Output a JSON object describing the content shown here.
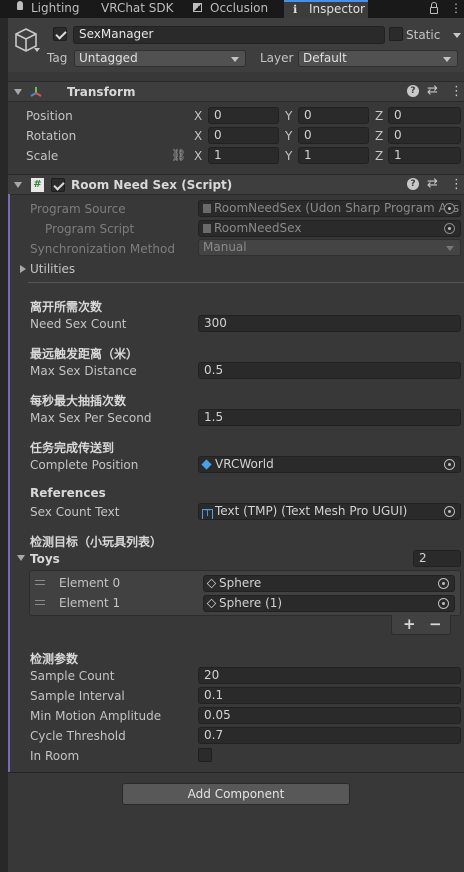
{
  "tabs": [
    {
      "label": "Lighting",
      "icon": "lightbulb-icon"
    },
    {
      "label": "VRChat SDK"
    },
    {
      "label": "Occlusion",
      "icon": "occlusion-icon"
    },
    {
      "label": "Inspector",
      "icon": "info-icon"
    }
  ],
  "gameobject": {
    "name": "SexManager",
    "static_label": "Static",
    "tag_label": "Tag",
    "tag_value": "Untagged",
    "layer_label": "Layer",
    "layer_value": "Default"
  },
  "transform": {
    "title": "Transform",
    "rows": [
      {
        "label": "Position",
        "x": "0",
        "y": "0",
        "z": "0"
      },
      {
        "label": "Rotation",
        "x": "0",
        "y": "0",
        "z": "0"
      },
      {
        "label": "Scale",
        "x": "1",
        "y": "1",
        "z": "1"
      }
    ],
    "axis": {
      "x": "X",
      "y": "Y",
      "z": "Z"
    }
  },
  "script": {
    "title": "Room Need Sex (Script)",
    "program_source_label": "Program Source",
    "program_source_value": "RoomNeedSex (Udon Sharp Program Ass",
    "program_script_label": "Program Script",
    "program_script_value": "RoomNeedSex",
    "sync_label": "Synchronization Method",
    "sync_value": "Manual",
    "utilities_label": "Utilities"
  },
  "sections": {
    "need_count_header": "离开所需次数",
    "need_count_label": "Need Sex Count",
    "need_count_value": "300",
    "max_dist_header": "最远触发距离（米）",
    "max_dist_label": "Max Sex Distance",
    "max_dist_value": "0.5",
    "max_per_sec_header": "每秒最大抽插次数",
    "max_per_sec_label": "Max Sex Per Second",
    "max_per_sec_value": "1.5",
    "complete_header": "任务完成传送到",
    "complete_label": "Complete Position",
    "complete_value": "VRCWorld",
    "references_header": "References",
    "sex_count_text_label": "Sex Count Text",
    "sex_count_text_value": "Text (TMP) (Text Mesh Pro UGUI)",
    "detect_header": "检测目标（小玩具列表）",
    "toys_label": "Toys",
    "toys_count": "2",
    "elements": [
      {
        "label": "Element 0",
        "value": "Sphere"
      },
      {
        "label": "Element 1",
        "value": "Sphere (1)"
      }
    ],
    "add_symbol": "+",
    "remove_symbol": "−",
    "params_header": "检测参数",
    "sample_count_label": "Sample Count",
    "sample_count_value": "20",
    "sample_interval_label": "Sample Interval",
    "sample_interval_value": "0.1",
    "min_motion_label": "Min Motion Amplitude",
    "min_motion_value": "0.05",
    "cycle_label": "Cycle Threshold",
    "cycle_value": "0.7",
    "in_room_label": "In Room"
  },
  "add_component_label": "Add Component",
  "colors": {
    "accent": "#4d8de6",
    "script_bar": "#7a6cb4"
  }
}
